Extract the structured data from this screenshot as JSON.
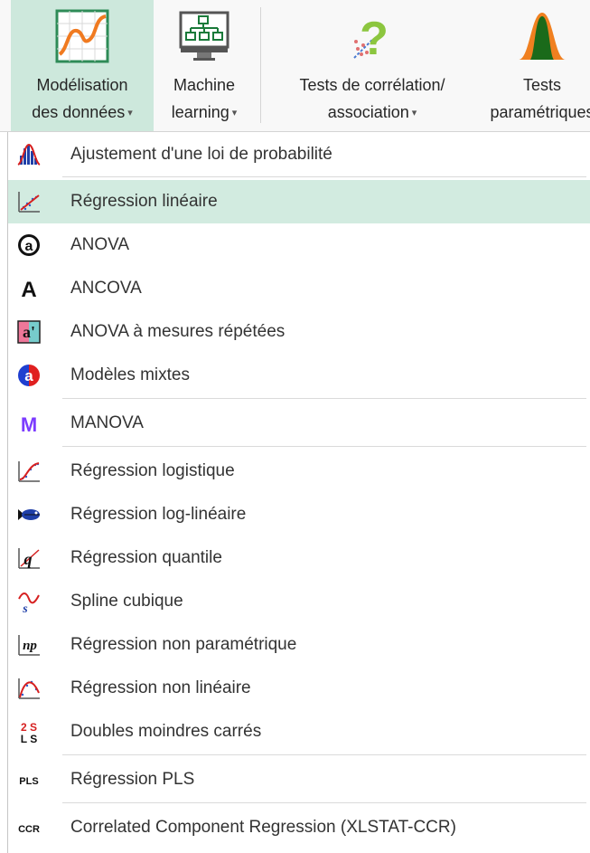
{
  "ribbon": {
    "buttons": [
      {
        "line1": "Modélisation",
        "line2": "des données",
        "icon": "chart-curve-icon"
      },
      {
        "line1": "Machine",
        "line2": "learning",
        "icon": "network-monitor-icon"
      },
      {
        "line1": "Tests de corrélation/",
        "line2": "association",
        "icon": "question-scatter-icon"
      },
      {
        "line1": "Tests",
        "line2": "paramétriques",
        "icon": "bell-curve-icon"
      }
    ],
    "caret": "▾"
  },
  "menu": {
    "items": [
      {
        "label": "Ajustement d'une loi de probabilité",
        "icon": "histogram-icon"
      },
      {
        "label": "Régression linéaire",
        "icon": "linear-regression-icon",
        "highlighted": true
      },
      {
        "label": "ANOVA",
        "icon": "anova-icon",
        "glyph": "@"
      },
      {
        "label": "ANCOVA",
        "icon": "ancova-icon",
        "glyph": "A"
      },
      {
        "label": "ANOVA à mesures répétées",
        "icon": "repeated-measures-icon",
        "glyph": "a'"
      },
      {
        "label": "Modèles mixtes",
        "icon": "mixed-models-icon",
        "glyph": "a"
      },
      {
        "label": "MANOVA",
        "icon": "manova-icon",
        "glyph": "M"
      },
      {
        "label": "Régression logistique",
        "icon": "logistic-regression-icon"
      },
      {
        "label": "Régression log-linéaire",
        "icon": "fish-icon"
      },
      {
        "label": "Régression quantile",
        "icon": "quantile-regression-icon",
        "glyph": "q"
      },
      {
        "label": "Spline cubique",
        "icon": "spline-icon",
        "glyph": "s"
      },
      {
        "label": "Régression non paramétrique",
        "icon": "nonparametric-icon",
        "glyph": "np"
      },
      {
        "label": "Régression non linéaire",
        "icon": "nonlinear-regression-icon"
      },
      {
        "label": "Doubles moindres carrés",
        "icon": "two-sls-icon",
        "glyph1": "2 S",
        "glyph2": "L S"
      },
      {
        "label": "Régression PLS",
        "icon": "pls-icon",
        "glyph": "PLS"
      },
      {
        "label": "Correlated Component Regression (XLSTAT-CCR)",
        "icon": "ccr-icon",
        "glyph": "CCR"
      }
    ]
  },
  "colors": {
    "selected_ribbon": "#cde8dc",
    "hover_item": "#d2ebe0",
    "icon_blue": "#1f3fa8",
    "icon_red": "#d62020",
    "icon_orange": "#f08020",
    "icon_green": "#1a6a1a",
    "manova_purple": "#7c3cff"
  }
}
